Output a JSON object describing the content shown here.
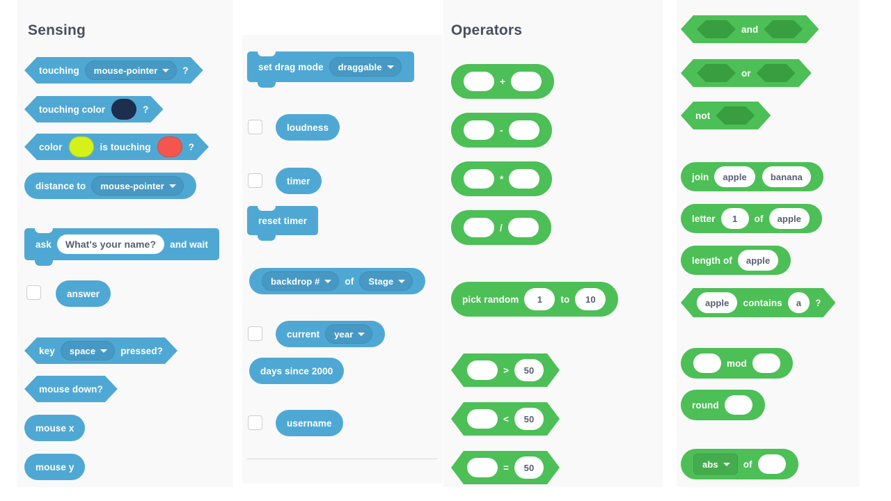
{
  "meta": {
    "bg": "#ffffff",
    "panel_bg": "#f9f9f9",
    "sensing_color": "#4FA8D3",
    "operator_color": "#4CBF56",
    "operator_dark": "#389E40",
    "text_color": "#484f60"
  },
  "categories": {
    "sensing_title": "Sensing",
    "operators_title": "Operators"
  },
  "sensing": {
    "touching": {
      "label": "touching",
      "dropdown": "mouse-pointer",
      "suffix": "?"
    },
    "touching_color": {
      "label": "touching color",
      "color": "#1e2e4f",
      "suffix": "?"
    },
    "color_is_touching": {
      "label": "color",
      "color1": "#d4f21a",
      "mid": "is touching",
      "color2": "#f4564e",
      "suffix": "?"
    },
    "distance_to": {
      "label": "distance to",
      "dropdown": "mouse-pointer"
    },
    "ask": {
      "label": "ask",
      "value": "What's your name?",
      "suffix": "and wait"
    },
    "answer": {
      "label": "answer",
      "checked": false
    },
    "key_pressed": {
      "label": "key",
      "dropdown": "space",
      "suffix": "pressed?"
    },
    "mouse_down": {
      "label": "mouse down?"
    },
    "mouse_x": {
      "label": "mouse x"
    },
    "mouse_y": {
      "label": "mouse y"
    },
    "set_drag_mode": {
      "label": "set drag mode",
      "dropdown": "draggable"
    },
    "loudness": {
      "label": "loudness",
      "checked": false
    },
    "timer": {
      "label": "timer",
      "checked": false
    },
    "reset_timer": {
      "label": "reset timer"
    },
    "backdrop_of": {
      "dropdown1": "backdrop #",
      "mid": "of",
      "dropdown2": "Stage"
    },
    "current": {
      "label": "current",
      "dropdown": "year",
      "checked": false
    },
    "days_since_2000": {
      "label": "days since 2000"
    },
    "username": {
      "label": "username",
      "checked": false
    }
  },
  "operators": {
    "add": {
      "symbol": "+"
    },
    "subtract": {
      "symbol": "-"
    },
    "multiply": {
      "symbol": "*"
    },
    "divide": {
      "symbol": "/"
    },
    "pick_random": {
      "label": "pick random",
      "from": "1",
      "mid": "to",
      "to": "10"
    },
    "greater": {
      "symbol": ">",
      "value": "50"
    },
    "less": {
      "symbol": "<",
      "value": "50"
    },
    "equals": {
      "symbol": "=",
      "value": "50"
    },
    "and": {
      "label": "and"
    },
    "or": {
      "label": "or"
    },
    "not": {
      "label": "not"
    },
    "join": {
      "label": "join",
      "value1": "apple",
      "value2": "banana"
    },
    "letter_of": {
      "label": "letter",
      "index": "1",
      "mid": "of",
      "text": "apple"
    },
    "length_of": {
      "label": "length of",
      "text": "apple"
    },
    "contains": {
      "text": "apple",
      "mid": "contains",
      "value": "a",
      "suffix": "?"
    },
    "mod": {
      "label": "mod"
    },
    "round": {
      "label": "round"
    },
    "math_op": {
      "dropdown": "abs",
      "mid": "of"
    }
  }
}
